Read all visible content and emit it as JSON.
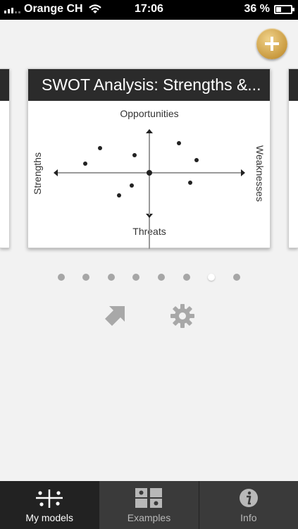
{
  "status_bar": {
    "carrier": "Orange CH",
    "time": "17:06",
    "battery": "36 %",
    "battery_level_percent": 36
  },
  "add_button": {
    "icon": "plus-icon",
    "color": "#c99a3f"
  },
  "card": {
    "title": "SWOT Analysis: Strengths &...",
    "labels": {
      "top": "Opportunities",
      "bottom": "Threats",
      "left": "Strengths",
      "right": "Weaknesses"
    }
  },
  "pager": {
    "count": 8,
    "active_index": 6
  },
  "actions": [
    {
      "name": "share",
      "icon": "share-arrow-icon"
    },
    {
      "name": "settings",
      "icon": "gear-icon"
    }
  ],
  "tabs": [
    {
      "label": "My models",
      "icon": "my-models-icon",
      "active": true
    },
    {
      "label": "Examples",
      "icon": "examples-grid-icon",
      "active": false
    },
    {
      "label": "Info",
      "icon": "info-icon",
      "active": false
    }
  ]
}
